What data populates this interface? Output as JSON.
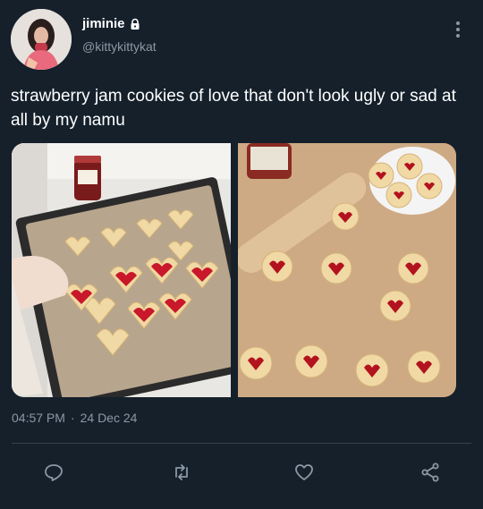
{
  "tweet": {
    "display_name": "jiminie",
    "handle": "@kittykittykat",
    "text": "strawberry jam cookies of love that don't look ugly or sad at all by my namu",
    "time": "04:57 PM",
    "separator": "·",
    "date": "24 Dec 24"
  },
  "icons": {
    "lock": "lock-icon",
    "more": "more-vertical-icon",
    "reply": "reply-icon",
    "retweet": "retweet-icon",
    "like": "heart-icon",
    "share": "share-icon"
  },
  "colors": {
    "background": "#15202b",
    "secondary_text": "#8b98a5",
    "divider": "#38444d"
  }
}
